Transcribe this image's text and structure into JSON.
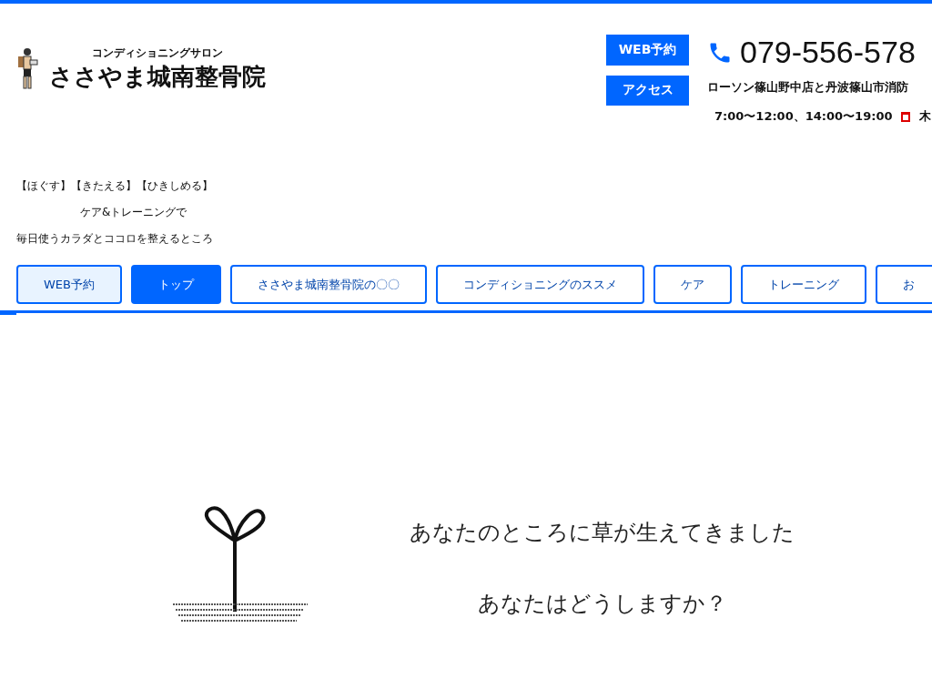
{
  "header": {
    "subtitle": "コンディショニングサロン",
    "title": "ささやま城南整骨院",
    "buttons": [
      "WEB予約",
      "アクセス"
    ],
    "phone": "079-556-578",
    "address": "ローソン篠山野中店と丹波篠山市消防",
    "hours": "7:00〜12:00、14:00〜19:00",
    "closed": "木"
  },
  "tagline": [
    "【ほぐす】【きたえる】【ひきしめる】",
    "ケア&トレーニングで",
    "毎日使うカラダとココロを整えるところ"
  ],
  "nav": [
    {
      "label": "WEB予約",
      "kind": "reserve",
      "selected": false
    },
    {
      "label": "トップ",
      "kind": "page",
      "selected": true
    },
    {
      "label": "ささやま城南整骨院の〇〇",
      "kind": "page",
      "selected": false
    },
    {
      "label": "コンディショニングのススメ",
      "kind": "page",
      "selected": false
    },
    {
      "label": "ケア",
      "kind": "page",
      "selected": false
    },
    {
      "label": "トレーニング",
      "kind": "page",
      "selected": false
    },
    {
      "label": "お",
      "kind": "page",
      "selected": false
    }
  ],
  "intro": [
    "あなたのところに草が生えてきました",
    "あなたはどうしますか？"
  ]
}
